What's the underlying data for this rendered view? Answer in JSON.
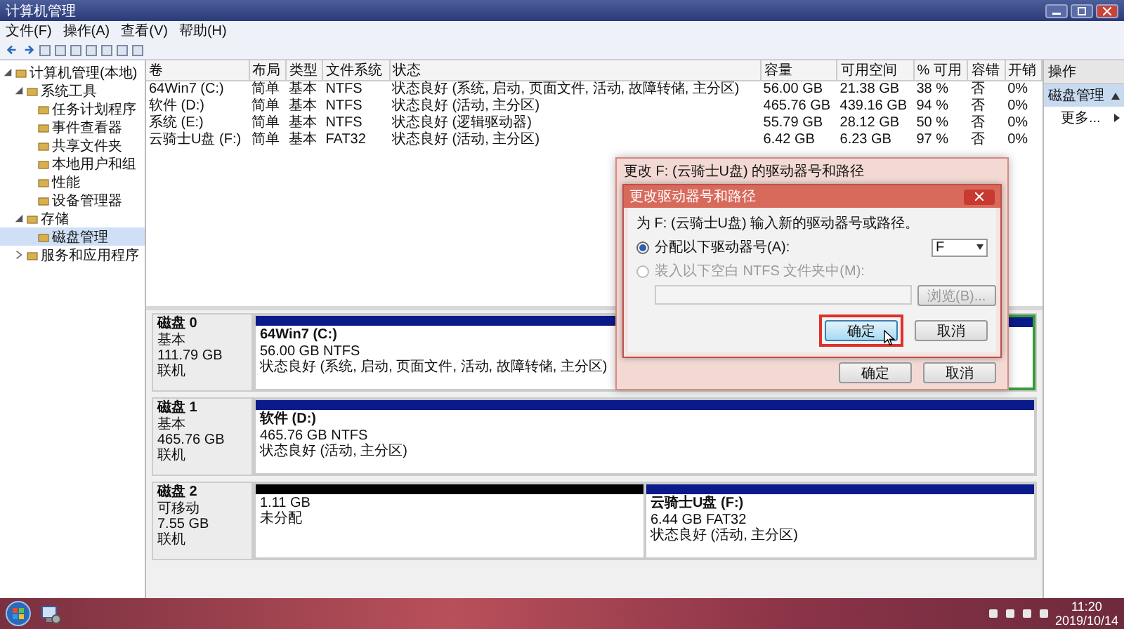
{
  "window": {
    "title": "计算机管理"
  },
  "menu": [
    "文件(F)",
    "操作(A)",
    "查看(V)",
    "帮助(H)"
  ],
  "tree": [
    {
      "label": "计算机管理(本地)",
      "expanded": true,
      "selected": false,
      "children": [
        {
          "label": "系统工具",
          "expanded": true,
          "selected": false,
          "children": [
            {
              "label": "任务计划程序",
              "selected": false
            },
            {
              "label": "事件查看器",
              "selected": false
            },
            {
              "label": "共享文件夹",
              "selected": false
            },
            {
              "label": "本地用户和组",
              "selected": false
            },
            {
              "label": "性能",
              "selected": false
            },
            {
              "label": "设备管理器",
              "selected": false
            }
          ]
        },
        {
          "label": "存储",
          "expanded": true,
          "selected": false,
          "children": [
            {
              "label": "磁盘管理",
              "selected": true
            }
          ]
        },
        {
          "label": "服务和应用程序",
          "expanded": false,
          "selected": false
        }
      ]
    }
  ],
  "volumes": {
    "columns": [
      "卷",
      "布局",
      "类型",
      "文件系统",
      "状态",
      "容量",
      "可用空间",
      "% 可用",
      "容错",
      "开销"
    ],
    "rows": [
      [
        "64Win7 (C:)",
        "简单",
        "基本",
        "NTFS",
        "状态良好 (系统, 启动, 页面文件, 活动, 故障转储, 主分区)",
        "56.00 GB",
        "21.38 GB",
        "38 %",
        "否",
        "0%"
      ],
      [
        "软件 (D:)",
        "简单",
        "基本",
        "NTFS",
        "状态良好 (活动, 主分区)",
        "465.76 GB",
        "439.16 GB",
        "94 %",
        "否",
        "0%"
      ],
      [
        "系统 (E:)",
        "简单",
        "基本",
        "NTFS",
        "状态良好 (逻辑驱动器)",
        "55.79 GB",
        "28.12 GB",
        "50 %",
        "否",
        "0%"
      ],
      [
        "云骑士U盘 (F:)",
        "简单",
        "基本",
        "FAT32",
        "状态良好 (活动, 主分区)",
        "6.42 GB",
        "6.23 GB",
        "97 %",
        "否",
        "0%"
      ]
    ]
  },
  "disks": [
    {
      "name": "磁盘 0",
      "type": "基本",
      "size": "111.79 GB",
      "status": "联机",
      "partitions": [
        {
          "kind": "primary",
          "selected": false,
          "label": "64Win7  (C:)",
          "size": "56.00 GB NTFS",
          "status": "状态良好 (系统, 启动, 页面文件, 活动, 故障转储, 主分区)"
        },
        {
          "kind": "primary",
          "selected": true
        }
      ]
    },
    {
      "name": "磁盘 1",
      "type": "基本",
      "size": "465.76 GB",
      "status": "联机",
      "partitions": [
        {
          "kind": "primary",
          "selected": false,
          "label": "软件  (D:)",
          "size": "465.76 GB NTFS",
          "status": "状态良好 (活动, 主分区)"
        }
      ]
    },
    {
      "name": "磁盘 2",
      "type": "可移动",
      "size": "7.55 GB",
      "status": "联机",
      "partitions": [
        {
          "kind": "unallocated",
          "selected": false,
          "size": "1.11 GB",
          "status": "未分配"
        },
        {
          "kind": "primary",
          "selected": false,
          "label": "云骑士U盘  (F:)",
          "size": "6.44 GB FAT32",
          "status": "状态良好 (活动, 主分区)"
        }
      ]
    }
  ],
  "actions": {
    "header": "操作",
    "section": "磁盘管理",
    "more": "更多..."
  },
  "dialog": {
    "title": "更改 F: (云骑士U盘) 的驱动器号和路径",
    "buttons": [
      "确定",
      "取消"
    ],
    "inner": {
      "title": "更改驱动器号和路径",
      "prompt": "为 F: (云骑士U盘) 输入新的驱动器号或路径。",
      "options": [
        {
          "label": "分配以下驱动器号(A):",
          "selected": true,
          "disabled": false
        },
        {
          "label": "装入以下空白 NTFS 文件夹中(M):",
          "selected": false,
          "disabled": true
        }
      ],
      "drive_letter": "F",
      "browse": {
        "label": "浏览(B)...",
        "disabled": true
      },
      "buttons": [
        {
          "label": "确定",
          "focused": true
        },
        {
          "label": "取消",
          "focused": false
        }
      ]
    }
  },
  "taskbar": {
    "time": "11:20",
    "date": "2019/10/14"
  }
}
